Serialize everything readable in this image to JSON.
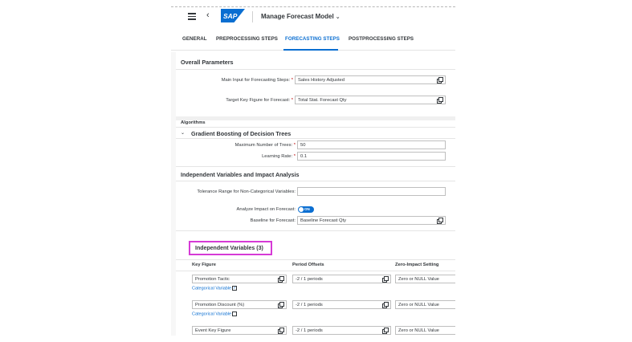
{
  "shell": {
    "app_title": "Manage Forecast Model",
    "logo_text": "SAP",
    "back_glyph": "‹",
    "chevron_glyph": "⌄"
  },
  "tabs": [
    {
      "label": "GENERAL",
      "active": false
    },
    {
      "label": "PREPROCESSING STEPS",
      "active": false
    },
    {
      "label": "FORECASTING STEPS",
      "active": true
    },
    {
      "label": "POSTPROCESSING STEPS",
      "active": false
    }
  ],
  "overall": {
    "title": "Overall Parameters",
    "main_input_label": "Main Input for Forecasting Steps:",
    "main_input_value": "Sales History Adjusted",
    "target_label": "Target Key Figure for Forecast:",
    "target_value": "Total Stat. Forecast Qty"
  },
  "algorithms": {
    "title": "Algorithms",
    "gb_title": "Gradient Boosting of Decision Trees",
    "gb_chevron": "⌄",
    "max_trees_label": "Maximum Number of Trees:",
    "max_trees_value": "50",
    "learning_rate_label": "Learning Rate:",
    "learning_rate_value": "0.1"
  },
  "independent": {
    "title": "Independent Variables and Impact Analysis",
    "tolerance_label": "Tolerance Range for Non-Categorical Variables:",
    "tolerance_value": "",
    "analyze_label": "Analyze Impact on Forecast:",
    "analyze_toggle": "ON",
    "baseline_label": "Baseline for Forecast:",
    "baseline_value": "Baseline Forecast Qty"
  },
  "variables": {
    "title": "Independent Variables (3)",
    "columns": [
      "Key Figure",
      "Period Offsets",
      "Zero-Impact Setting"
    ],
    "categorical_label": "Categorical Variable",
    "rows": [
      {
        "key_figure": "Promotion Tactic",
        "offsets": "-2 / 1 periods",
        "zero_impact": "Zero or NULL Value",
        "categorical": true
      },
      {
        "key_figure": "Promotion Discount (%)",
        "offsets": "-2 / 1 periods",
        "zero_impact": "Zero or NULL Value",
        "categorical": false
      },
      {
        "key_figure": "Event Key Figure",
        "offsets": "-2 / 1 periods",
        "zero_impact": "Zero or NULL Value",
        "categorical": null
      }
    ]
  },
  "colors": {
    "accent": "#0a6ed1",
    "highlight": "#d63ad6",
    "required": "#bb0000"
  }
}
